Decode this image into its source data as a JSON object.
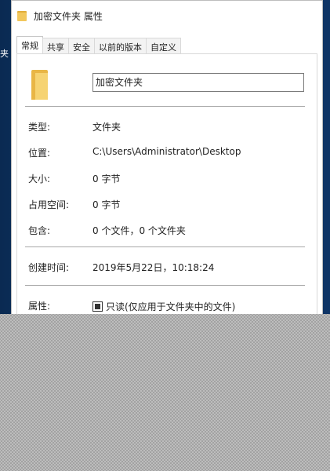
{
  "window": {
    "title": "加密文件夹 属性",
    "desktop_glyph": "夹"
  },
  "tabs": [
    {
      "label": "常规",
      "active": true
    },
    {
      "label": "共享",
      "active": false
    },
    {
      "label": "安全",
      "active": false
    },
    {
      "label": "以前的版本",
      "active": false
    },
    {
      "label": "自定义",
      "active": false
    }
  ],
  "general": {
    "folder_name": "加密文件夹",
    "type_label": "类型:",
    "type_value": "文件夹",
    "location_label": "位置:",
    "location_value": "C:\\Users\\Administrator\\Desktop",
    "size_label": "大小:",
    "size_value": "0 字节",
    "disk_size_label": "占用空间:",
    "disk_size_value": "0 字节",
    "contains_label": "包含:",
    "contains_value": "0 个文件，0 个文件夹",
    "created_label": "创建时间:",
    "created_value": "2019年5月22日，10:18:24",
    "attributes_label": "属性:",
    "readonly_label": "只读(仅应用于文件夹中的文件)"
  },
  "colors": {
    "folder_yellow": "#f6d372",
    "folder_dark": "#e9b646",
    "desktop_blue": "#0f3566"
  },
  "icons": {
    "title": "folder-icon",
    "main": "folder-icon"
  }
}
